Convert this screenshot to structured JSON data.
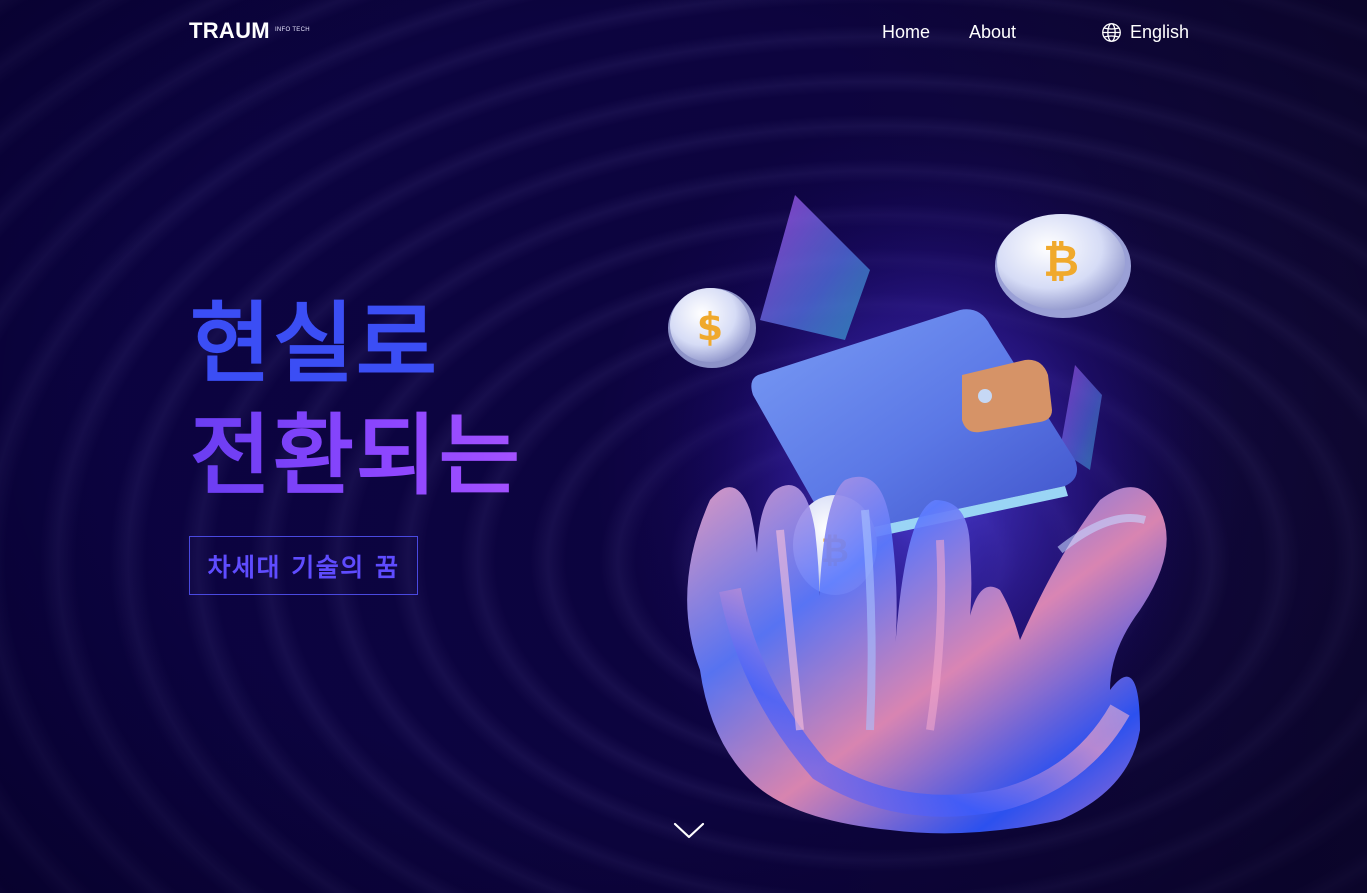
{
  "header": {
    "logo": {
      "name": "TRAUM",
      "sub": "INFO TECH"
    },
    "nav": [
      {
        "label": "Home"
      },
      {
        "label": "About"
      }
    ],
    "language": {
      "label": "English",
      "icon": "globe-icon"
    }
  },
  "hero": {
    "headline_line1": "현실로",
    "headline_line2": "전환되는",
    "tagline": "차세대 기술의 꿈",
    "scroll_icon": "chevron-down-icon"
  },
  "colors": {
    "background": "#0c0340",
    "headline_blue": "#3b4ef5",
    "headline_purple": "#8d46ff",
    "tagline": "#5f4cff"
  }
}
